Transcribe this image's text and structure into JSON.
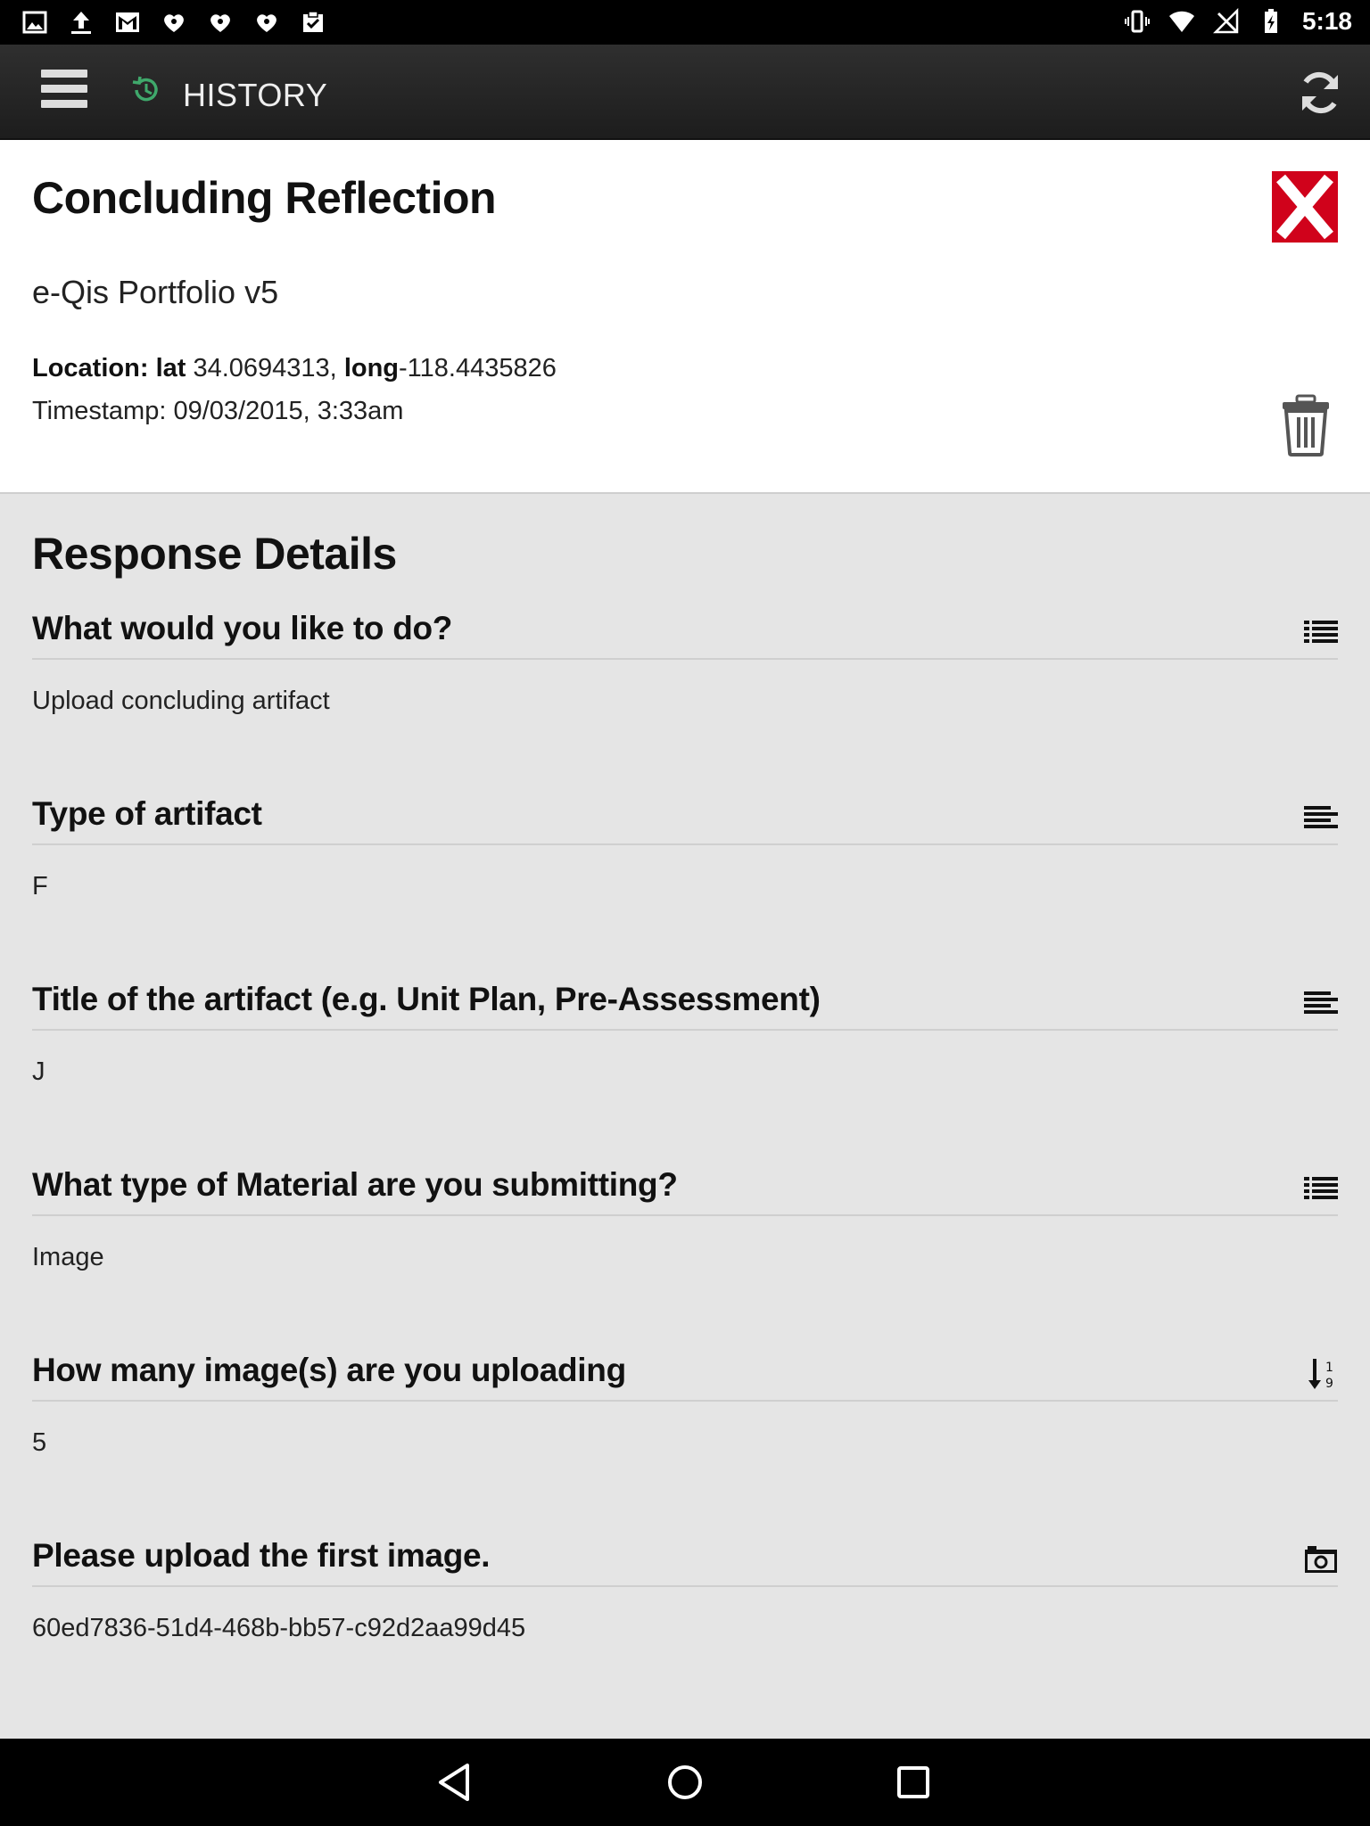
{
  "status_bar": {
    "time": "5:18",
    "left_icons": [
      "gallery-icon",
      "upload-icon",
      "gmail-icon",
      "iheartradio-icon",
      "iheartradio-icon",
      "iheartradio-icon",
      "clipboard-check-icon"
    ],
    "right_icons": [
      "vibrate-icon",
      "wifi-icon",
      "no-signal-icon",
      "battery-charging-icon"
    ]
  },
  "app_bar": {
    "title": "HISTORY",
    "accent_color": "#3fa86b"
  },
  "header": {
    "title": "Concluding Reflection",
    "subtitle": "e-Qis Portfolio v5",
    "location_label": "Location:",
    "lat_label": "lat",
    "lat_value": "34.0694313,",
    "long_label": "long",
    "long_value": "-118.4435826",
    "timestamp": "Timestamp: 09/03/2015, 3:33am",
    "close_color": "#d0021b"
  },
  "details": {
    "title": "Response Details",
    "items": [
      {
        "question": "What would you like to do?",
        "answer": "Upload concluding artifact",
        "icon": "list-icon"
      },
      {
        "question": "Type of artifact",
        "answer": "F",
        "icon": "text-lines-icon"
      },
      {
        "question": "Title of the artifact (e.g. Unit Plan, Pre-Assessment)",
        "answer": "J",
        "icon": "text-lines-icon"
      },
      {
        "question": "What type of Material are you submitting?",
        "answer": "Image",
        "icon": "list-icon"
      },
      {
        "question": "How many image(s) are you uploading",
        "answer": "5",
        "icon": "numeric-sort-icon"
      },
      {
        "question": "Please upload the first image.",
        "answer": "60ed7836-51d4-468b-bb57-c92d2aa99d45",
        "icon": "camera-icon"
      }
    ]
  },
  "nav_bar": {
    "buttons": [
      "back-icon",
      "home-icon",
      "recents-icon"
    ]
  }
}
